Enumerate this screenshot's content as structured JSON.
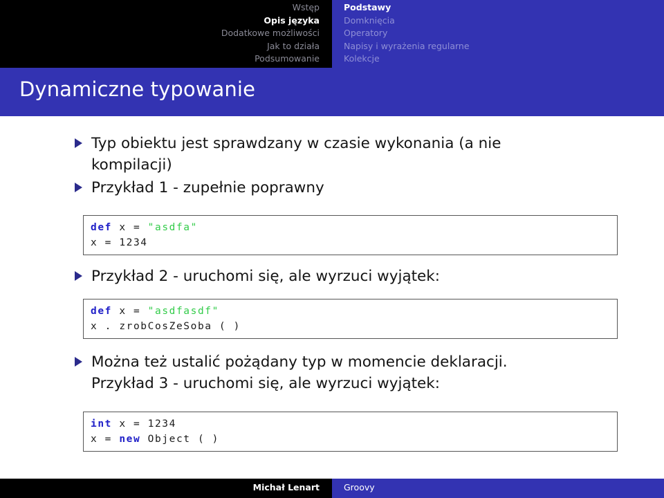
{
  "header": {
    "nav_left": [
      {
        "label": "Wstęp",
        "active": false
      },
      {
        "label": "Opis języka",
        "active": true
      },
      {
        "label": "Dodatkowe możliwości",
        "active": false
      },
      {
        "label": "Jak to działa",
        "active": false
      },
      {
        "label": "Podsumowanie",
        "active": false
      }
    ],
    "nav_right": [
      {
        "label": "Podstawy",
        "active": true
      },
      {
        "label": "Domknięcia",
        "active": false
      },
      {
        "label": "Operatory",
        "active": false
      },
      {
        "label": "Napisy i wyrażenia regularne",
        "active": false
      },
      {
        "label": "Kolekcje",
        "active": false
      }
    ]
  },
  "slide": {
    "title": "Dynamiczne typowanie",
    "bullets": [
      {
        "line1": "Typ obiektu jest sprawdzany w czasie wykonania (a nie",
        "line2": "kompilacji)"
      },
      {
        "line1": "Przykład 1 - zupełnie poprawny",
        "line2": ""
      },
      {
        "line1": "Przykład 2 - uruchomi się, ale wyrzuci wyjątek:",
        "line2": ""
      },
      {
        "line1": "Można też ustalić pożądany typ w momencie deklaracji.",
        "line2": "Przykład 3 - uruchomi się, ale wyrzuci wyjątek:"
      }
    ],
    "code_blocks": [
      {
        "line1": {
          "kw": "def",
          "mid": " x = ",
          "str": "\"asdfa\"",
          "tail": ""
        },
        "line2": {
          "kw": "",
          "mid": "x = 1234",
          "str": "",
          "tail": ""
        }
      },
      {
        "line1": {
          "kw": "def",
          "mid": " x = ",
          "str": "\"asdfasdf\"",
          "tail": ""
        },
        "line2": {
          "kw": "",
          "mid": "x . zrobCosZeSoba ( )",
          "str": "",
          "tail": ""
        }
      },
      {
        "line1": {
          "kw": "int",
          "mid": " x = 1234",
          "str": "",
          "tail": ""
        },
        "line2": {
          "kw": "",
          "mid": "x = ",
          "str": "",
          "tail": "new",
          "after": " Object ( )"
        }
      }
    ]
  },
  "footer": {
    "author": "Michał Lenart",
    "subject": "Groovy"
  },
  "colors": {
    "brand_blue": "#3333b2",
    "keyword_blue": "#2020c8",
    "string_green": "#33cc4a",
    "bullet_marker": "#2b2b8c",
    "header_black": "#000000"
  }
}
